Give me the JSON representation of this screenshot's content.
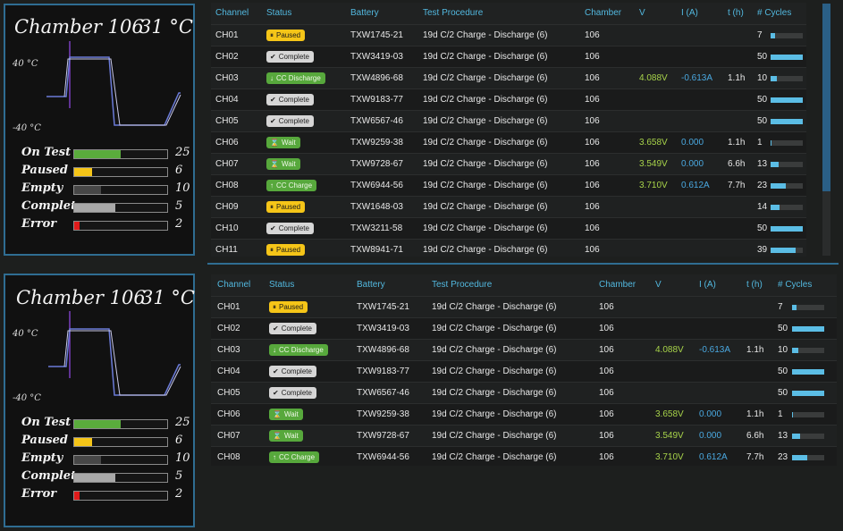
{
  "panel": {
    "title": "Chamber 106",
    "temp": "31 °C",
    "temp_high": "40 °C",
    "temp_low": "-40 °C",
    "stats": [
      {
        "label": "On Test",
        "value": "25",
        "color": "#5aac3c",
        "fraction": 0.5
      },
      {
        "label": "Paused",
        "value": "6",
        "color": "#f5c518",
        "fraction": 0.19
      },
      {
        "label": "Empty",
        "value": "10",
        "color": "#474747",
        "fraction": 0.29
      },
      {
        "label": "Complete",
        "value": "5",
        "color": "#a8a8a8",
        "fraction": 0.44
      },
      {
        "label": "Error",
        "value": "2",
        "color": "#e01b1b",
        "fraction": 0.06
      }
    ]
  },
  "columns": [
    "Channel",
    "Status",
    "Battery",
    "Test Procedure",
    "Chamber",
    "V",
    "I (A)",
    "t (h)",
    "# Cycles"
  ],
  "rows": [
    {
      "channel": "CH01",
      "status": "Paused",
      "status_type": "paused",
      "icon": "⏸",
      "battery": "TXW1745-21",
      "procedure": "19d C/2 Charge - Discharge (6)",
      "chamber": "106",
      "v": "",
      "i": "",
      "t": "",
      "cycles": "7",
      "cycle_fraction": 0.14
    },
    {
      "channel": "CH02",
      "status": "Complete",
      "status_type": "complete",
      "icon": "✔",
      "battery": "TXW3419-03",
      "procedure": "19d C/2 Charge - Discharge (6)",
      "chamber": "106",
      "v": "",
      "i": "",
      "t": "",
      "cycles": "50",
      "cycle_fraction": 1.0
    },
    {
      "channel": "CH03",
      "status": "CC Discharge",
      "status_type": "cc",
      "icon": "↓",
      "battery": "TXW4896-68",
      "procedure": "19d C/2 Charge - Discharge (6)",
      "chamber": "106",
      "v": "4.088V",
      "i": "-0.613A",
      "t": "1.1h",
      "cycles": "10",
      "cycle_fraction": 0.2
    },
    {
      "channel": "CH04",
      "status": "Complete",
      "status_type": "complete",
      "icon": "✔",
      "battery": "TXW9183-77",
      "procedure": "19d C/2 Charge - Discharge (6)",
      "chamber": "106",
      "v": "",
      "i": "",
      "t": "",
      "cycles": "50",
      "cycle_fraction": 1.0
    },
    {
      "channel": "CH05",
      "status": "Complete",
      "status_type": "complete",
      "icon": "✔",
      "battery": "TXW6567-46",
      "procedure": "19d C/2 Charge - Discharge (6)",
      "chamber": "106",
      "v": "",
      "i": "",
      "t": "",
      "cycles": "50",
      "cycle_fraction": 1.0
    },
    {
      "channel": "CH06",
      "status": "Wait",
      "status_type": "wait",
      "icon": "⌛",
      "battery": "TXW9259-38",
      "procedure": "19d C/2 Charge - Discharge (6)",
      "chamber": "106",
      "v": "3.658V",
      "i": "0.000",
      "t": "1.1h",
      "cycles": "1",
      "cycle_fraction": 0.02
    },
    {
      "channel": "CH07",
      "status": "Wait",
      "status_type": "wait",
      "icon": "⌛",
      "battery": "TXW9728-67",
      "procedure": "19d C/2 Charge - Discharge (6)",
      "chamber": "106",
      "v": "3.549V",
      "i": "0.000",
      "t": "6.6h",
      "cycles": "13",
      "cycle_fraction": 0.26
    },
    {
      "channel": "CH08",
      "status": "CC Charge",
      "status_type": "cc",
      "icon": "↑",
      "battery": "TXW6944-56",
      "procedure": "19d C/2 Charge - Discharge (6)",
      "chamber": "106",
      "v": "3.710V",
      "i": "0.612A",
      "t": "7.7h",
      "cycles": "23",
      "cycle_fraction": 0.46
    },
    {
      "channel": "CH09",
      "status": "Paused",
      "status_type": "paused",
      "icon": "⏸",
      "battery": "TXW1648-03",
      "procedure": "19d C/2 Charge - Discharge (6)",
      "chamber": "106",
      "v": "",
      "i": "",
      "t": "",
      "cycles": "14",
      "cycle_fraction": 0.28
    },
    {
      "channel": "CH10",
      "status": "Complete",
      "status_type": "complete",
      "icon": "✔",
      "battery": "TXW3211-58",
      "procedure": "19d C/2 Charge - Discharge (6)",
      "chamber": "106",
      "v": "",
      "i": "",
      "t": "",
      "cycles": "50",
      "cycle_fraction": 1.0
    },
    {
      "channel": "CH11",
      "status": "Paused",
      "status_type": "paused",
      "icon": "⏸",
      "battery": "TXW8941-71",
      "procedure": "19d C/2 Charge - Discharge (6)",
      "chamber": "106",
      "v": "",
      "i": "",
      "t": "",
      "cycles": "39",
      "cycle_fraction": 0.78
    }
  ]
}
